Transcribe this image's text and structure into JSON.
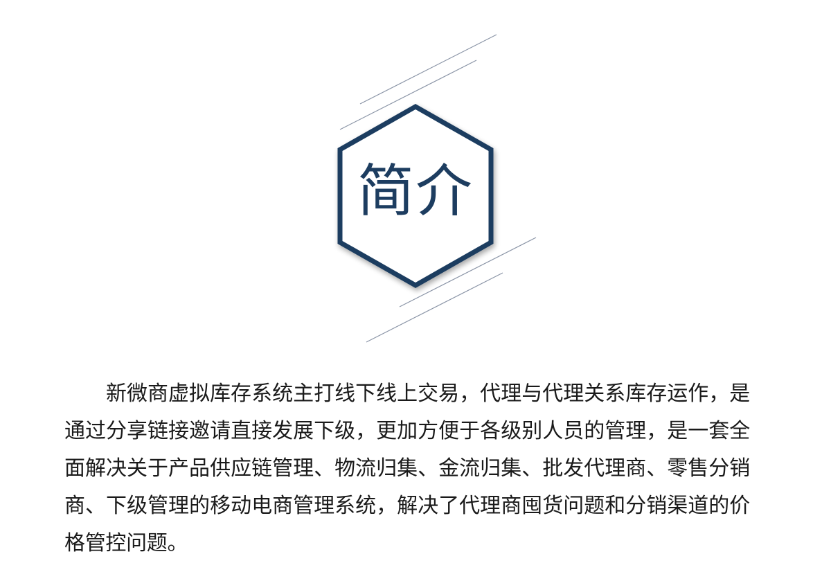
{
  "header": {
    "title": "简介",
    "icon": "hexagon-frame-icon",
    "accent_color": "#1d3d60",
    "line_color": "#8a94a6"
  },
  "intro": {
    "text": "新微商虚拟库存系统主打线下线上交易，代理与代理关系库存运作，是通过分享链接邀请直接发展下级，更加方便于各级别人员的管理，是一套全面解决关于产品供应链管理、物流归集、金流归集、批发代理商、零售分销商、下级管理的移动电商管理系统，解决了代理商囤货问题和分销渠道的价格管控问题。"
  }
}
